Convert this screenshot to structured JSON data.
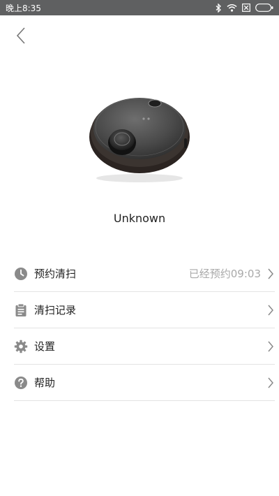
{
  "status_bar": {
    "time": "晚上8:35",
    "icons": [
      "bluetooth-icon",
      "wifi-icon",
      "no-sim-icon",
      "battery-icon"
    ]
  },
  "header": {
    "back_icon": "chevron-left-icon"
  },
  "device": {
    "name": "Unknown",
    "image": "robot-vacuum"
  },
  "menu": {
    "items": [
      {
        "label": "预约清扫",
        "value": "已经预约09:03",
        "icon": "clock-icon"
      },
      {
        "label": "清扫记录",
        "icon": "clipboard-icon"
      },
      {
        "label": "设置",
        "icon": "gear-icon"
      },
      {
        "label": "帮助",
        "icon": "help-icon"
      }
    ]
  },
  "colors": {
    "status_bar_bg": "#5f6061",
    "icon_gray": "#8a8a8a",
    "value_gray": "#a9a9a9",
    "divider": "#e3e3e3"
  }
}
